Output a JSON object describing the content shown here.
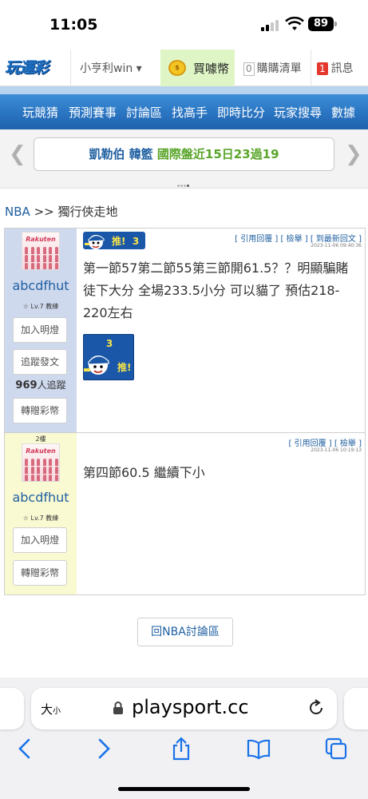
{
  "status": {
    "time": "11:05",
    "battery": "89"
  },
  "site": {
    "logo_text": "玩運彩",
    "user_menu": "小亨利win ▾",
    "buy_coins": "買噱幣",
    "cart_count": "0",
    "cart_label": "購購清單",
    "msg_count": "1",
    "msg_label": "訊息"
  },
  "nav": {
    "items": [
      "玩競猜",
      "預測賽事",
      "討論區",
      "找高手",
      "即時比分",
      "玩家搜尋",
      "數據"
    ]
  },
  "ticker": {
    "team": "凱勒伯 韓籃",
    "text": "國際盤近15日23過19"
  },
  "breadcrumb": {
    "link": "NBA",
    "sep": ">>",
    "current": "獨行俠走地"
  },
  "posts": [
    {
      "floor": "",
      "username": "abcdfhut",
      "level": "☆ Lv.7 教練",
      "follow_btn": "加入明燈",
      "track_btn": "追蹤發文",
      "followers_count": "969",
      "followers_suffix": "人追蹤",
      "gift_btn": "轉贈彩幣",
      "tools": "[ 引用回覆 ]  [ 檢舉 ]  [ 到最新回文 ]",
      "timestamp": "2023-11-06 09:40:36",
      "push_label": "推!",
      "push_count": "3",
      "content": "第一節57第二節55第三節開61.5？？明顯騙賭徒下大分 全場233.5小分 可以貓了 預估218-220左右"
    },
    {
      "floor": "2樓",
      "username": "abcdfhut",
      "level": "☆ Lv.7 教練",
      "follow_btn": "加入明燈",
      "gift_btn": "轉贈彩幣",
      "tools": "[ 引用回覆 ]  [ 檢舉 ]",
      "timestamp": "2023-11-06 10:19:13",
      "content": "第四節60.5 繼續下小"
    }
  ],
  "back_button": "回NBA討論區",
  "browser": {
    "size_label": "大",
    "size_small": "小",
    "url": "playsport.cc"
  }
}
